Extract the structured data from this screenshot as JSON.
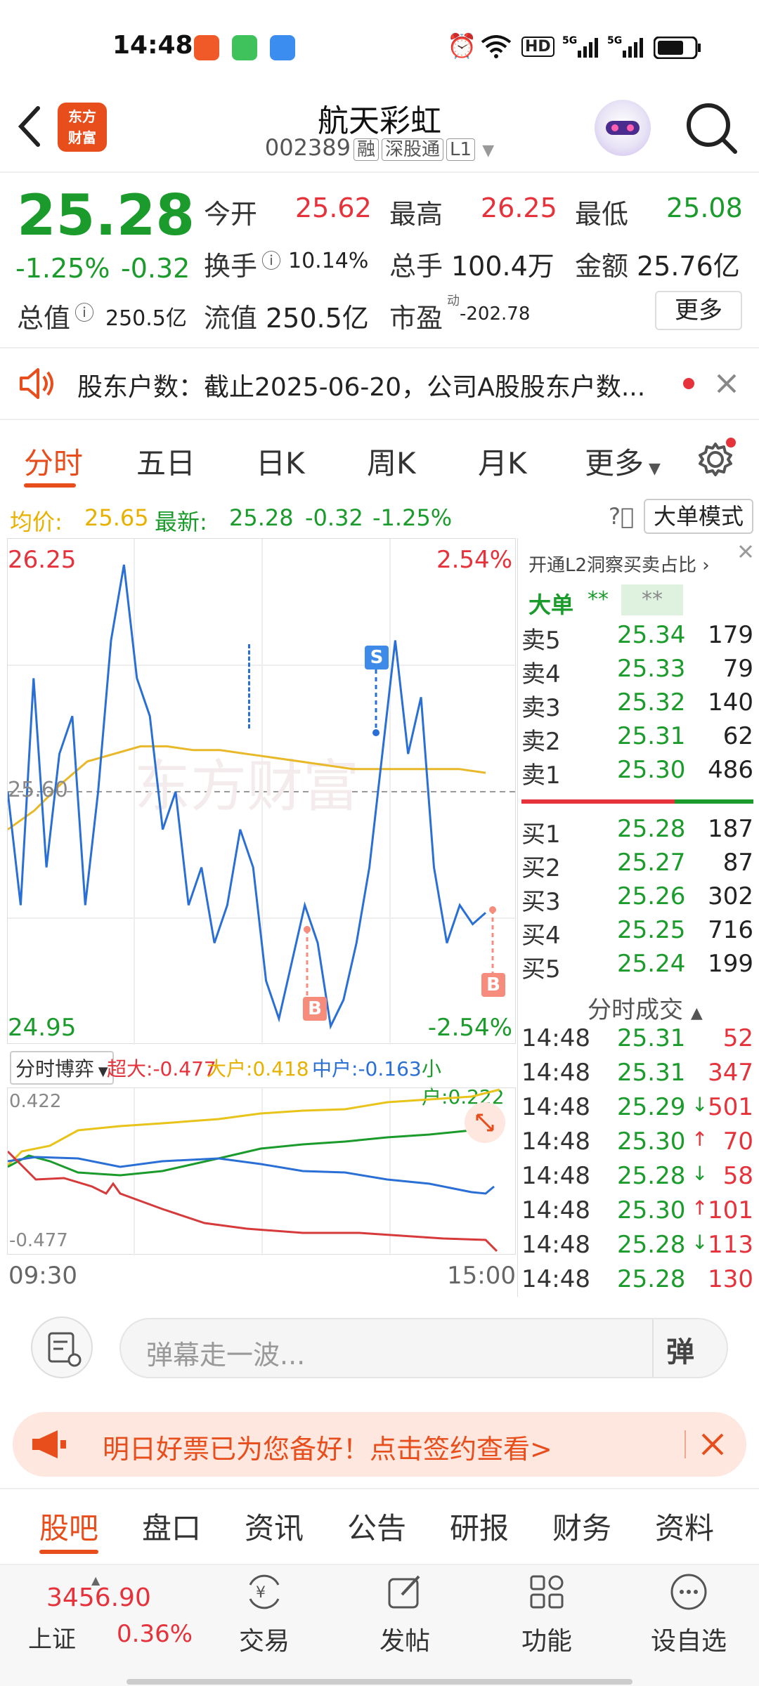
{
  "status_bar": {
    "time": "14:48"
  },
  "header": {
    "back_label": "‹",
    "logo_line1": "东方",
    "logo_line2": "财富",
    "title": "航天彩虹",
    "code": "002389",
    "tags": [
      "融",
      "深股通",
      "L1"
    ]
  },
  "quote": {
    "price": "25.28",
    "change_pct": "-1.25%",
    "change": "-0.32",
    "open_label": "今开",
    "open": "25.62",
    "high_label": "最高",
    "high": "26.25",
    "low_label": "最低",
    "low": "25.08",
    "turnover_label": "换手",
    "turnover": "10.14%",
    "volume_label": "总手",
    "volume": "100.4万",
    "amount_label": "金额",
    "amount": "25.76亿",
    "mcap_label": "总值",
    "mcap": "250.5亿",
    "float_label": "流值",
    "float": "250.5亿",
    "pe_label": "市盈",
    "pe_sup": "动",
    "pe": "-202.78",
    "more": "更多"
  },
  "notice": {
    "text": "股东户数：截止2025-06-20，公司A股股东户数..."
  },
  "tabs": [
    "分时",
    "五日",
    "日K",
    "周K",
    "月K",
    "更多"
  ],
  "info_row": {
    "avg_label": "均价:",
    "avg": "25.65",
    "latest_label": "最新:",
    "latest": "25.28",
    "latest_chg": "-0.32",
    "latest_pct": "-1.25%",
    "mode_button": "大单模式"
  },
  "chart": {
    "top_price": "26.25",
    "top_pct": "2.54%",
    "mid_price": "25.60",
    "bottom_price": "24.95",
    "bottom_pct": "-2.54%",
    "watermark": "东方财富",
    "marker_s": "S",
    "marker_b": "B",
    "start_time": "09:30",
    "end_time": "15:00"
  },
  "chart_data": {
    "type": "line",
    "series": [
      {
        "name": "price",
        "values": [
          25.6,
          25.3,
          25.9,
          25.4,
          25.7,
          25.8,
          25.3,
          25.6,
          26.0,
          26.2,
          25.9,
          25.8,
          25.5,
          25.6,
          25.3,
          25.4,
          25.2,
          25.3,
          25.5,
          25.4,
          25.1,
          25.0,
          25.15,
          25.3,
          25.2,
          24.98,
          25.05,
          25.2,
          25.4,
          25.7,
          26.0,
          25.7,
          25.85,
          25.4,
          25.2,
          25.3,
          25.25,
          25.28
        ]
      },
      {
        "name": "avg",
        "values": [
          25.5,
          25.55,
          25.62,
          25.68,
          25.7,
          25.72,
          25.72,
          25.71,
          25.71,
          25.7,
          25.69,
          25.68,
          25.67,
          25.66,
          25.66,
          25.66,
          25.66,
          25.66,
          25.65
        ]
      }
    ],
    "ylim": [
      24.95,
      26.25
    ]
  },
  "capital_flow": {
    "selector": "分时博弈",
    "super_label": "超大:",
    "super": "-0.477",
    "large_label": "大户:",
    "large": "0.418",
    "mid_label": "中户:",
    "mid": "-0.163",
    "small_label": "小户:",
    "small": "0.222",
    "max": "0.422",
    "min": "-0.477"
  },
  "order_book": {
    "header": "开通L2洞察买卖占比",
    "big_label": "大单",
    "big_mask1": "**",
    "big_mask2": "**",
    "asks": [
      {
        "label": "卖5",
        "price": "25.34",
        "vol": "179"
      },
      {
        "label": "卖4",
        "price": "25.33",
        "vol": "79"
      },
      {
        "label": "卖3",
        "price": "25.32",
        "vol": "140"
      },
      {
        "label": "卖2",
        "price": "25.31",
        "vol": "62"
      },
      {
        "label": "卖1",
        "price": "25.30",
        "vol": "486"
      }
    ],
    "bids": [
      {
        "label": "买1",
        "price": "25.28",
        "vol": "187"
      },
      {
        "label": "买2",
        "price": "25.27",
        "vol": "87"
      },
      {
        "label": "买3",
        "price": "25.26",
        "vol": "302"
      },
      {
        "label": "买4",
        "price": "25.25",
        "vol": "716"
      },
      {
        "label": "买5",
        "price": "25.24",
        "vol": "199"
      }
    ],
    "trades_header": "分时成交",
    "trades": [
      {
        "time": "14:48",
        "price": "25.31",
        "vol": "52",
        "arrow": ""
      },
      {
        "time": "14:48",
        "price": "25.31",
        "vol": "347",
        "arrow": ""
      },
      {
        "time": "14:48",
        "price": "25.29",
        "vol": "501",
        "arrow": "↓"
      },
      {
        "time": "14:48",
        "price": "25.30",
        "vol": "70",
        "arrow": "↑"
      },
      {
        "time": "14:48",
        "price": "25.28",
        "vol": "58",
        "arrow": "↓"
      },
      {
        "time": "14:48",
        "price": "25.30",
        "vol": "101",
        "arrow": "↑"
      },
      {
        "time": "14:48",
        "price": "25.28",
        "vol": "113",
        "arrow": "↓"
      },
      {
        "time": "14:48",
        "price": "25.28",
        "vol": "130",
        "arrow": ""
      }
    ]
  },
  "danmu": {
    "placeholder": "弹幕走一波...",
    "send": "弹"
  },
  "promo": {
    "text": "明日好票已为您备好！点击签约查看>"
  },
  "subnav": [
    "股吧",
    "盘口",
    "资讯",
    "公告",
    "研报",
    "财务",
    "资料"
  ],
  "bottom_bar": {
    "index_value": "3456.90",
    "index_name": "上证",
    "index_pct": "0.36%",
    "items": [
      "交易",
      "发帖",
      "功能",
      "设自选"
    ]
  }
}
